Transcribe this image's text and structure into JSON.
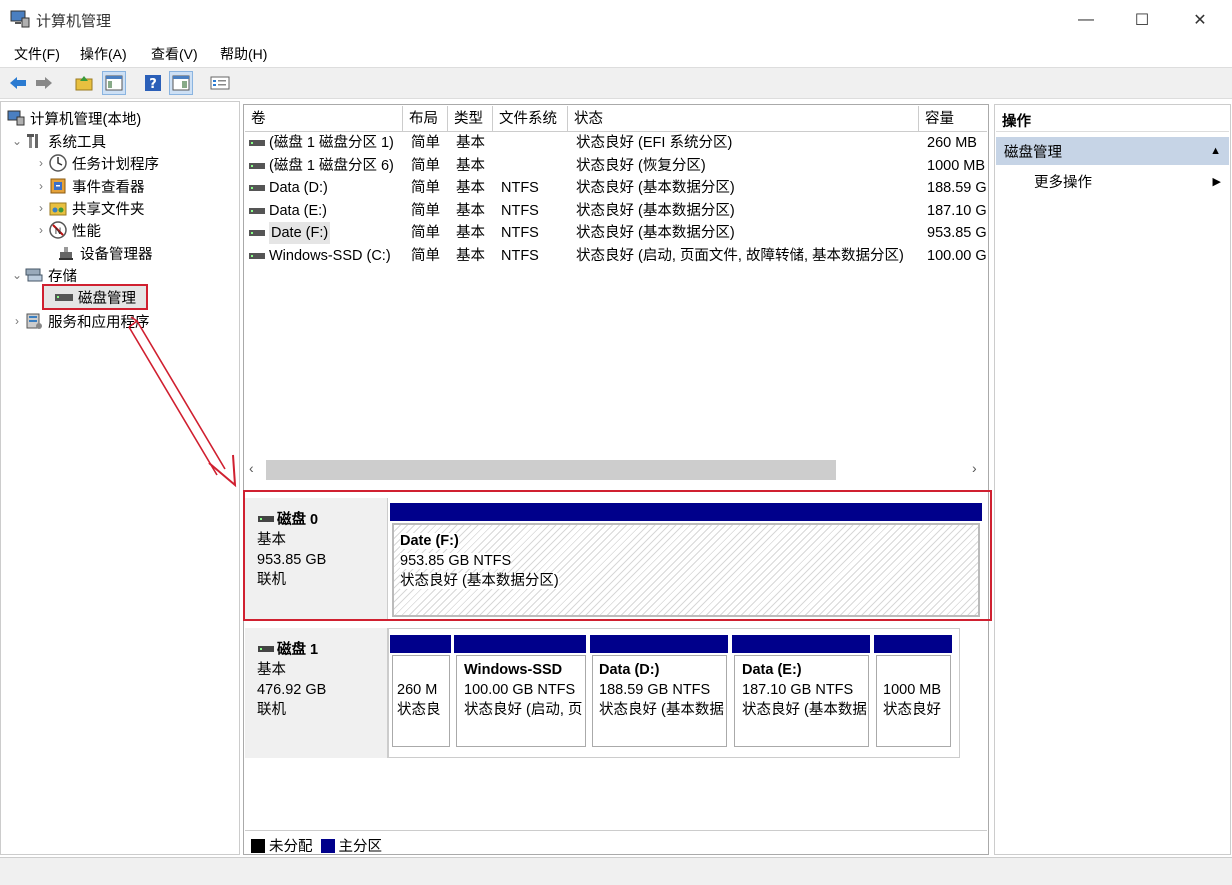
{
  "window": {
    "title": "计算机管理",
    "buttons": [
      "—",
      "☐",
      "✕"
    ]
  },
  "menu": [
    "文件(F)",
    "操作(A)",
    "查看(V)",
    "帮助(H)"
  ],
  "tree": {
    "root": "计算机管理(本地)",
    "system_tools": "系统工具",
    "task_scheduler": "任务计划程序",
    "event_viewer": "事件查看器",
    "shared_folders": "共享文件夹",
    "performance": "性能",
    "device_manager": "设备管理器",
    "storage": "存储",
    "disk_management": "磁盘管理",
    "services": "服务和应用程序"
  },
  "volume_table": {
    "columns": [
      "卷",
      "布局",
      "类型",
      "文件系统",
      "状态",
      "容量"
    ],
    "rows": [
      [
        "(磁盘 1 磁盘分区 1)",
        "简单",
        "基本",
        "",
        "状态良好 (EFI 系统分区)",
        "260 MB"
      ],
      [
        "(磁盘 1 磁盘分区 6)",
        "简单",
        "基本",
        "",
        "状态良好 (恢复分区)",
        "1000 MB"
      ],
      [
        "Data (D:)",
        "简单",
        "基本",
        "NTFS",
        "状态良好 (基本数据分区)",
        "188.59 G"
      ],
      [
        "Data (E:)",
        "简单",
        "基本",
        "NTFS",
        "状态良好 (基本数据分区)",
        "187.10 G"
      ],
      [
        "Date (F:)",
        "简单",
        "基本",
        "NTFS",
        "状态良好 (基本数据分区)",
        "953.85 G"
      ],
      [
        "Windows-SSD (C:)",
        "简单",
        "基本",
        "NTFS",
        "状态良好 (启动, 页面文件, 故障转储, 基本数据分区)",
        "100.00 G"
      ]
    ]
  },
  "scroll": {
    "left": "‹",
    "right": "›"
  },
  "disks": [
    {
      "name": "磁盘 0",
      "type": "基本",
      "size": "953.85 GB",
      "state": "联机",
      "partitions": [
        {
          "name": "Date  (F:)",
          "size": "953.85 GB NTFS",
          "status": "状态良好 (基本数据分区)"
        }
      ]
    },
    {
      "name": "磁盘 1",
      "type": "基本",
      "size": "476.92 GB",
      "state": "联机",
      "partitions": [
        {
          "name": "",
          "size": "260 M",
          "status": "状态良"
        },
        {
          "name": "Windows-SSD",
          "size": "100.00 GB NTFS",
          "status": "状态良好 (启动, 页"
        },
        {
          "name": "Data  (D:)",
          "size": "188.59 GB NTFS",
          "status": "状态良好 (基本数据"
        },
        {
          "name": "Data  (E:)",
          "size": "187.10 GB NTFS",
          "status": "状态良好 (基本数据"
        },
        {
          "name": "",
          "size": "1000 MB",
          "status": "状态良好"
        }
      ]
    }
  ],
  "legend": {
    "unallocated": "未分配",
    "primary": "主分区",
    "unallocated_color": "#000000",
    "primary_color": "#00008b"
  },
  "actions": {
    "header": "操作",
    "section": "磁盘管理",
    "more": "更多操作"
  },
  "colors": {
    "highlight": "#d02030",
    "section_bg": "#c6d4e6"
  }
}
